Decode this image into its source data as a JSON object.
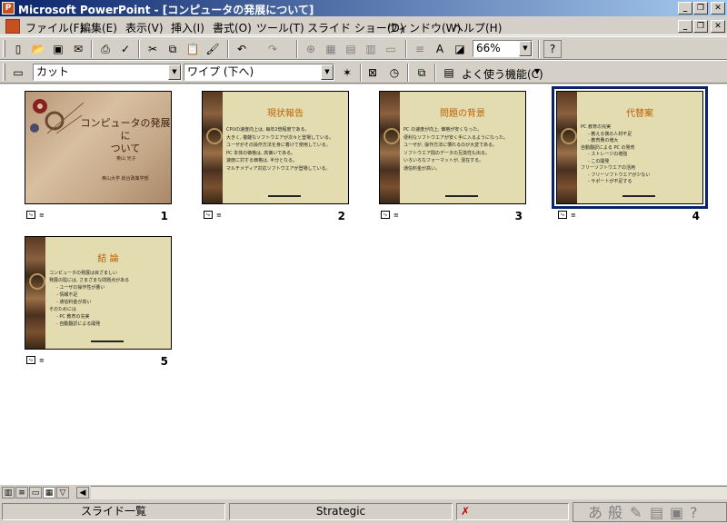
{
  "window": {
    "title": "Microsoft PowerPoint - [コンピュータの発展について]",
    "minimize": "_",
    "restore": "❐",
    "close": "✕"
  },
  "menubar": {
    "items": [
      "ファイル(F)",
      "編集(E)",
      "表示(V)",
      "挿入(I)",
      "書式(O)",
      "ツール(T)",
      "スライド ショー(D)",
      "ウィンドウ(W)",
      "ヘルプ(H)"
    ]
  },
  "toolbar": {
    "zoom": "66%",
    "help_icon": "?"
  },
  "toolbar2": {
    "transition": "カット",
    "animation": "ワイプ (下へ)",
    "common_tasks": "よく使う機能(C)"
  },
  "slides": [
    {
      "number": "1",
      "type": "cover",
      "title_line1": "コンピュータの発展に",
      "title_line2": "ついて",
      "author": "奥山 光子",
      "affiliation": "奥山大学 総合政策学部"
    },
    {
      "number": "2",
      "title": "現状報告",
      "bullets": [
        "CPUの速度向上は, 毎年2倍程度である。",
        "大きく, 複雑なソフトウエアが次々と登場している。",
        "ユーザがその操作方法を身に着けて使用している。",
        "PC 本体の価格は, 高価いである。",
        "速度に対する価格は, 半分となる。",
        "マルチメディア対応ソフトウエアが登場している。"
      ]
    },
    {
      "number": "3",
      "title": "問題の背景",
      "bullets": [
        "PC の速度が向上, 価格が安くなった。",
        "便利なソフトウエアが安く手に入るようになった。",
        "ユーザが, 操作方法に慣れるのが大変である。",
        "ソフトウエア間のデータの互換性も出る。",
        "いろいろなフォーマットが, 混在する。",
        "通信料金が高い。"
      ]
    },
    {
      "number": "4",
      "title": "代替案",
      "bullets": [
        "PC 教育の充実",
        "- 教える側の人材不足",
        "- 教育費の増大",
        "自動翻訳による PC の発育",
        "- ストレージの増強",
        "- この開発",
        "フリーソフトウエアの活用",
        "- フリーソフトウエアが少ない",
        "- サポートが不足する"
      ],
      "selected": true
    },
    {
      "number": "5",
      "title": "結 論",
      "bullets": [
        "コンピュータの発展は目ざましい",
        "発展の陰には, さまざまな問題点がある",
        "- ユーザの操作性が悪い",
        "- 情報不足",
        "- 通信料金が高い",
        "そのためには",
        "- PC 教育の充実",
        "- 自動翻訳による開発"
      ]
    }
  ],
  "statusbar": {
    "view": "スライド一覧",
    "design": "Strategic"
  },
  "ime": [
    "あ",
    "般"
  ]
}
